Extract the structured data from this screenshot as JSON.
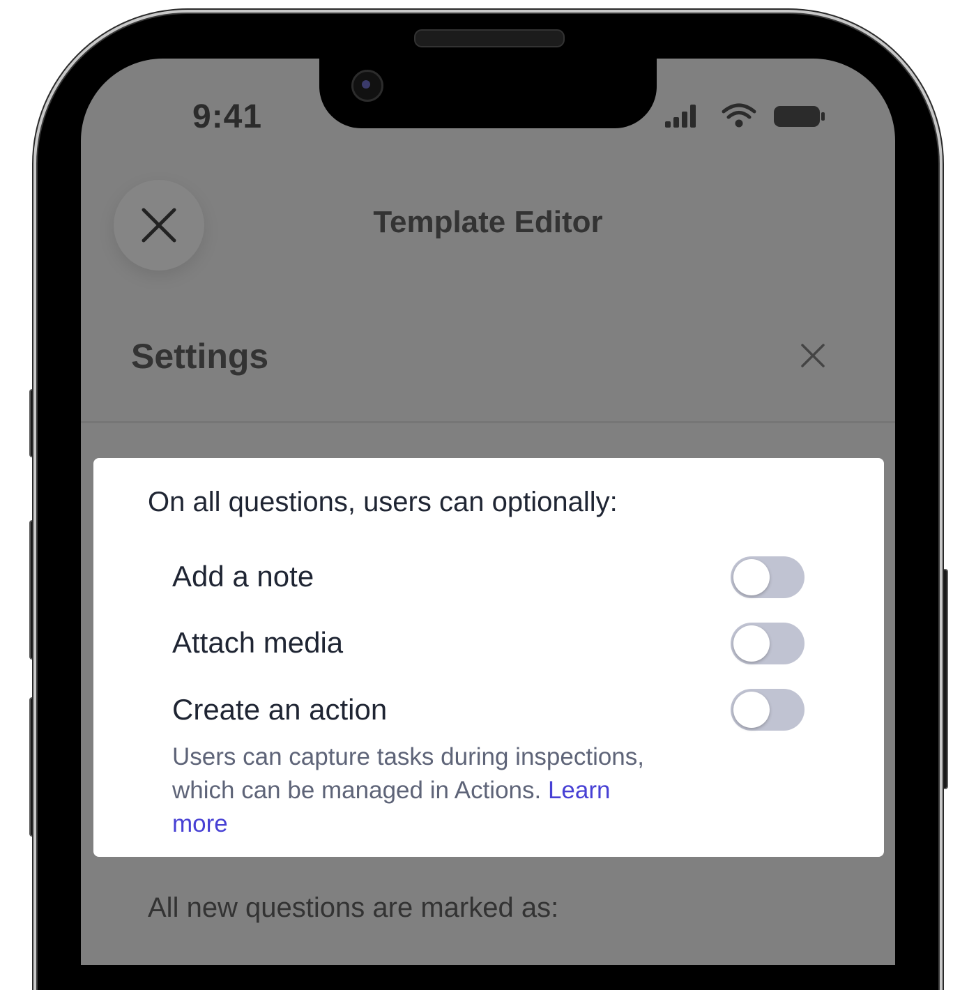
{
  "status_bar": {
    "time": "9:41",
    "icons": [
      "cellular-signal-icon",
      "wifi-icon",
      "battery-icon"
    ]
  },
  "header": {
    "close_icon": "close-icon",
    "title": "Template Editor"
  },
  "settings": {
    "title": "Settings",
    "close_icon": "close-icon"
  },
  "card": {
    "heading": "On all questions, users can optionally:",
    "options": [
      {
        "label": "Add a note",
        "enabled": false
      },
      {
        "label": "Attach media",
        "enabled": false
      },
      {
        "label": "Create an action",
        "enabled": false
      }
    ],
    "description": "Users can capture tasks during inspections, which can be managed in Actions.",
    "learn_more": "Learn more"
  },
  "below_card": {
    "text": "All new questions are marked as:"
  },
  "colors": {
    "overlay": "#808080",
    "card_bg": "#ffffff",
    "toggle_off": "#c0c3d2",
    "link": "#4740d4",
    "text_primary": "#1f2533",
    "text_secondary": "#5e6478"
  }
}
